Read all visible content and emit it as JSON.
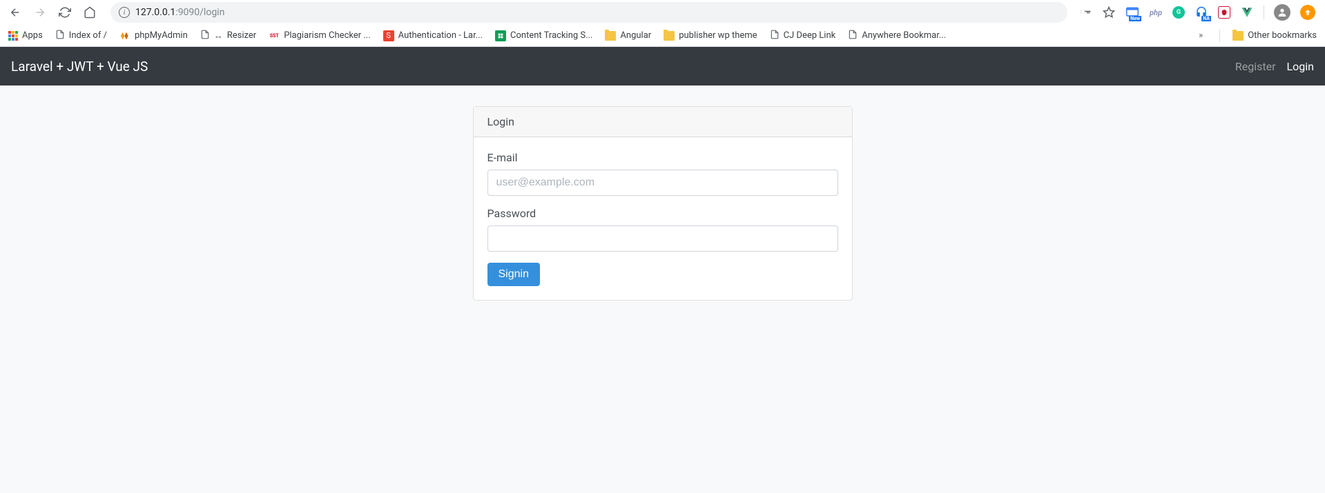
{
  "browser": {
    "url_host": "127.0.0.1",
    "url_path": ":9090/login"
  },
  "bookmarks": {
    "apps": "Apps",
    "items": [
      "Index of /",
      "phpMyAdmin",
      "Resizer",
      "Plagiarism Checker ...",
      "Authentication - Lar...",
      "Content Tracking S...",
      "Angular",
      "publisher wp theme",
      "CJ Deep Link",
      "Anywhere Bookmar..."
    ],
    "other": "Other bookmarks"
  },
  "navbar": {
    "brand": "Laravel + JWT + Vue JS",
    "register": "Register",
    "login": "Login"
  },
  "card": {
    "title": "Login",
    "email_label": "E-mail",
    "email_placeholder": "user@example.com",
    "password_label": "Password",
    "submit": "Signin"
  }
}
